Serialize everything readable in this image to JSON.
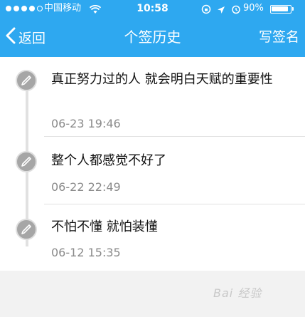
{
  "status_bar": {
    "carrier": "中国移动",
    "time": "10:58",
    "battery_percent_text": "90%",
    "battery_level": 0.9
  },
  "nav": {
    "back_label": "返回",
    "title": "个签历史",
    "right_label": "写签名"
  },
  "entries": [
    {
      "text": "真正努力过的人 就会明白天赋的重要性",
      "date": "06-23 19:46"
    },
    {
      "text": "整个人都感觉不好了",
      "date": "06-22 22:49"
    },
    {
      "text": "不怕不懂 就怕装懂",
      "date": "06-12 15:35"
    }
  ],
  "colors": {
    "header_blue": "#2ea8f0",
    "timeline_icon_gray": "#a6a6a6",
    "date_gray": "#8a8a8a"
  },
  "watermark": "Bai 经验"
}
